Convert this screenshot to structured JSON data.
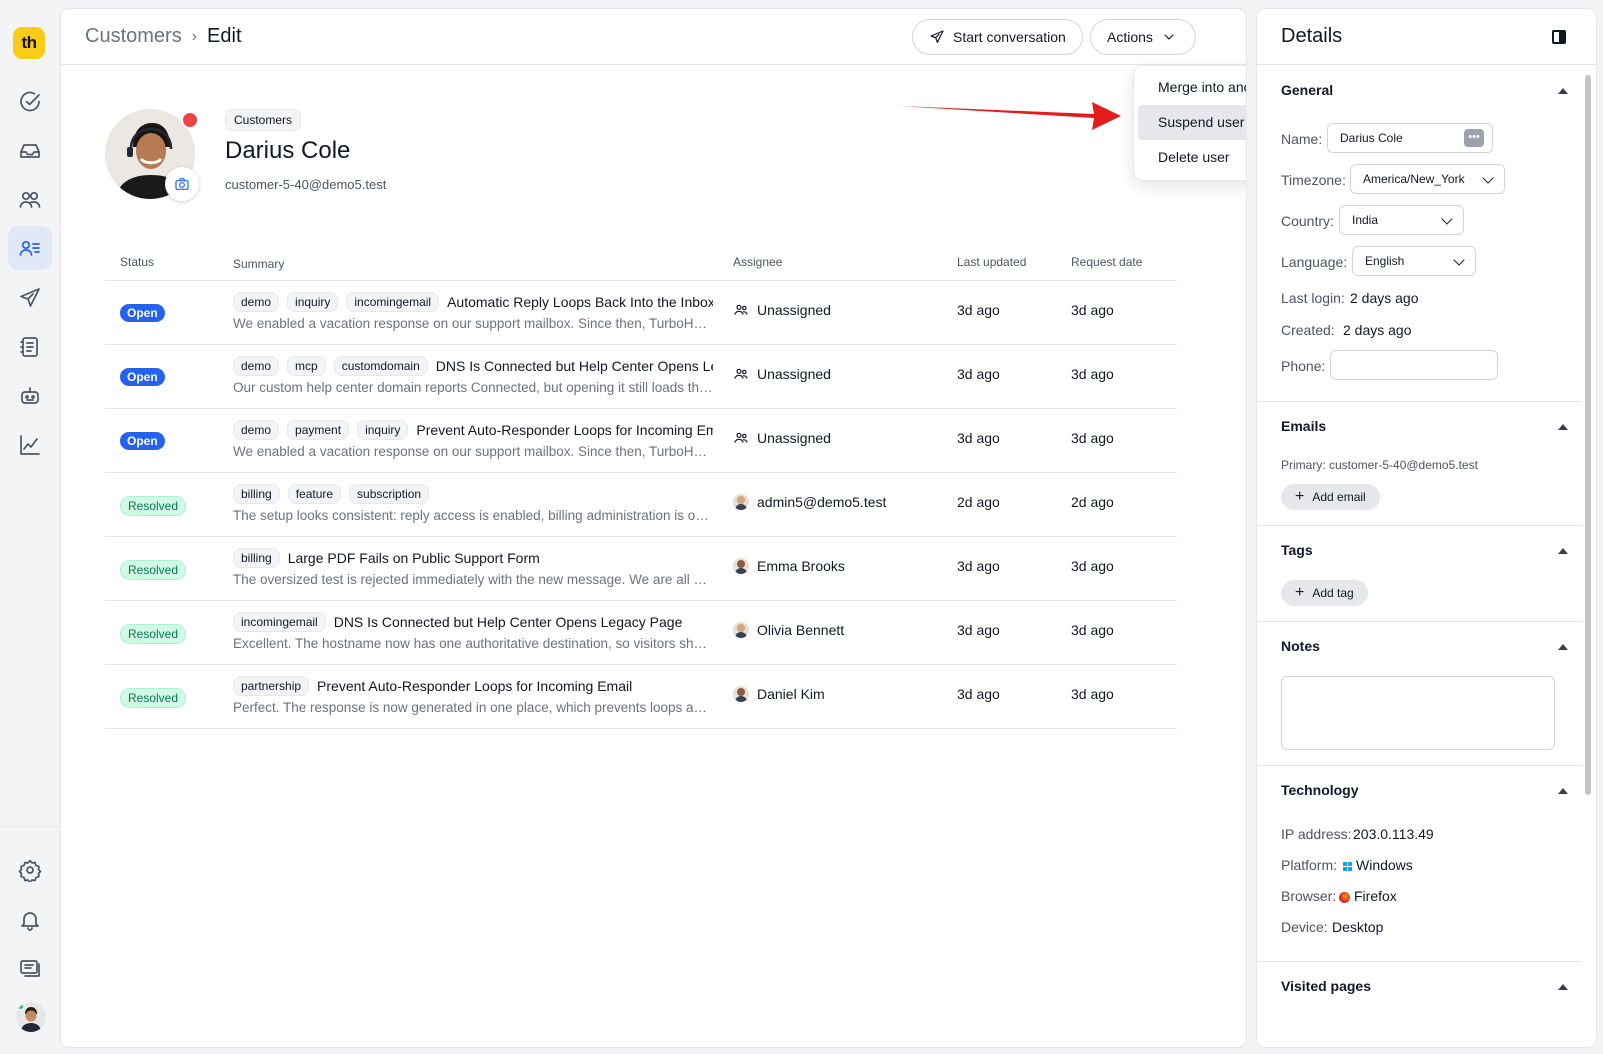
{
  "breadcrumb": {
    "parent": "Customers",
    "separator": "›",
    "current": "Edit"
  },
  "toolbar": {
    "start_conversation": "Start conversation",
    "actions": "Actions"
  },
  "actions_menu": {
    "items": [
      "Merge into another user",
      "Suspend user",
      "Delete user"
    ],
    "highlighted": "Suspend user"
  },
  "customer": {
    "group": "Customers",
    "name": "Darius Cole",
    "email": "customer-5-40@demo5.test"
  },
  "table": {
    "headers": {
      "status": "Status",
      "summary": "Summary",
      "assignee": "Assignee",
      "last_updated": "Last updated",
      "request_date": "Request date"
    },
    "rows": [
      {
        "status": "Open",
        "tags": [
          "demo",
          "inquiry",
          "incomingemail"
        ],
        "title": "Automatic Reply Loops Back Into the Inbox",
        "snippet": "We enabled a vacation response on our support mailbox. Since then, TurboHelp keeps creating new tickets",
        "assignee": "Unassigned",
        "last_updated": "3d ago",
        "request_date": "3d ago"
      },
      {
        "status": "Open",
        "tags": [
          "demo",
          "mcp",
          "customdomain"
        ],
        "title": "DNS Is Connected but Help Center Opens Legacy Page",
        "snippet": "Our custom help center domain reports Connected, but opening it still loads the old page",
        "assignee": "Unassigned",
        "last_updated": "3d ago",
        "request_date": "3d ago"
      },
      {
        "status": "Open",
        "tags": [
          "demo",
          "payment",
          "inquiry"
        ],
        "title": "Prevent Auto-Responder Loops for Incoming Email",
        "snippet": "We enabled a vacation response on our support mailbox. Since then, TurboHelp keeps creating new tickets",
        "assignee": "Unassigned",
        "last_updated": "3d ago",
        "request_date": "3d ago"
      },
      {
        "status": "Resolved",
        "tags": [
          "billing",
          "feature",
          "subscription"
        ],
        "title": "",
        "snippet": "The setup looks consistent: reply access is enabled, billing administration is only available to",
        "assignee": "admin5@demo5.test",
        "last_updated": "2d ago",
        "request_date": "2d ago"
      },
      {
        "status": "Resolved",
        "tags": [
          "billing"
        ],
        "title": "Large PDF Fails on Public Support Form",
        "snippet": "The oversized test is rejected immediately with the new message. We are all set now",
        "assignee": "Emma Brooks",
        "last_updated": "3d ago",
        "request_date": "3d ago"
      },
      {
        "status": "Resolved",
        "tags": [
          "incomingemail"
        ],
        "title": "DNS Is Connected but Help Center Opens Legacy Page",
        "snippet": "Excellent. The hostname now has one authoritative destination, so visitors should land correctly",
        "assignee": "Olivia Bennett",
        "last_updated": "3d ago",
        "request_date": "3d ago"
      },
      {
        "status": "Resolved",
        "tags": [
          "partnership"
        ],
        "title": "Prevent Auto-Responder Loops for Incoming Email",
        "snippet": "Perfect. The response is now generated in one place, which prevents loops and duplicates",
        "assignee": "Daniel Kim",
        "last_updated": "3d ago",
        "request_date": "3d ago"
      }
    ]
  },
  "details": {
    "title": "Details",
    "general": {
      "title": "General",
      "name_label": "Name:",
      "name_value": "Darius Cole",
      "name_key": "•••",
      "timezone_label": "Timezone:",
      "timezone_value": "America/New_York",
      "country_label": "Country:",
      "country_value": "India",
      "language_label": "Language:",
      "language_value": "English",
      "last_login_label": "Last login:",
      "last_login_value": "2 days ago",
      "created_label": "Created:",
      "created_value": "2 days ago",
      "phone_label": "Phone:",
      "phone_value": ""
    },
    "emails": {
      "title": "Emails",
      "primary": "Primary: customer-5-40@demo5.test",
      "add": "Add email"
    },
    "tags": {
      "title": "Tags",
      "add": "Add tag"
    },
    "notes": {
      "title": "Notes"
    },
    "technology": {
      "title": "Technology",
      "ip_label": "IP address:",
      "ip_value": "203.0.113.49",
      "platform_label": "Platform:",
      "platform_value": "Windows",
      "browser_label": "Browser:",
      "browser_value": "Firefox",
      "device_label": "Device:",
      "device_value": "Desktop"
    },
    "visited": {
      "title": "Visited pages"
    }
  },
  "colors": {
    "accent": "#2563eb",
    "logo": "#facc15",
    "open": "#2563eb",
    "resolved_bg": "#d1fae5",
    "arrow": "#e11d1d"
  },
  "logo_text": "th"
}
